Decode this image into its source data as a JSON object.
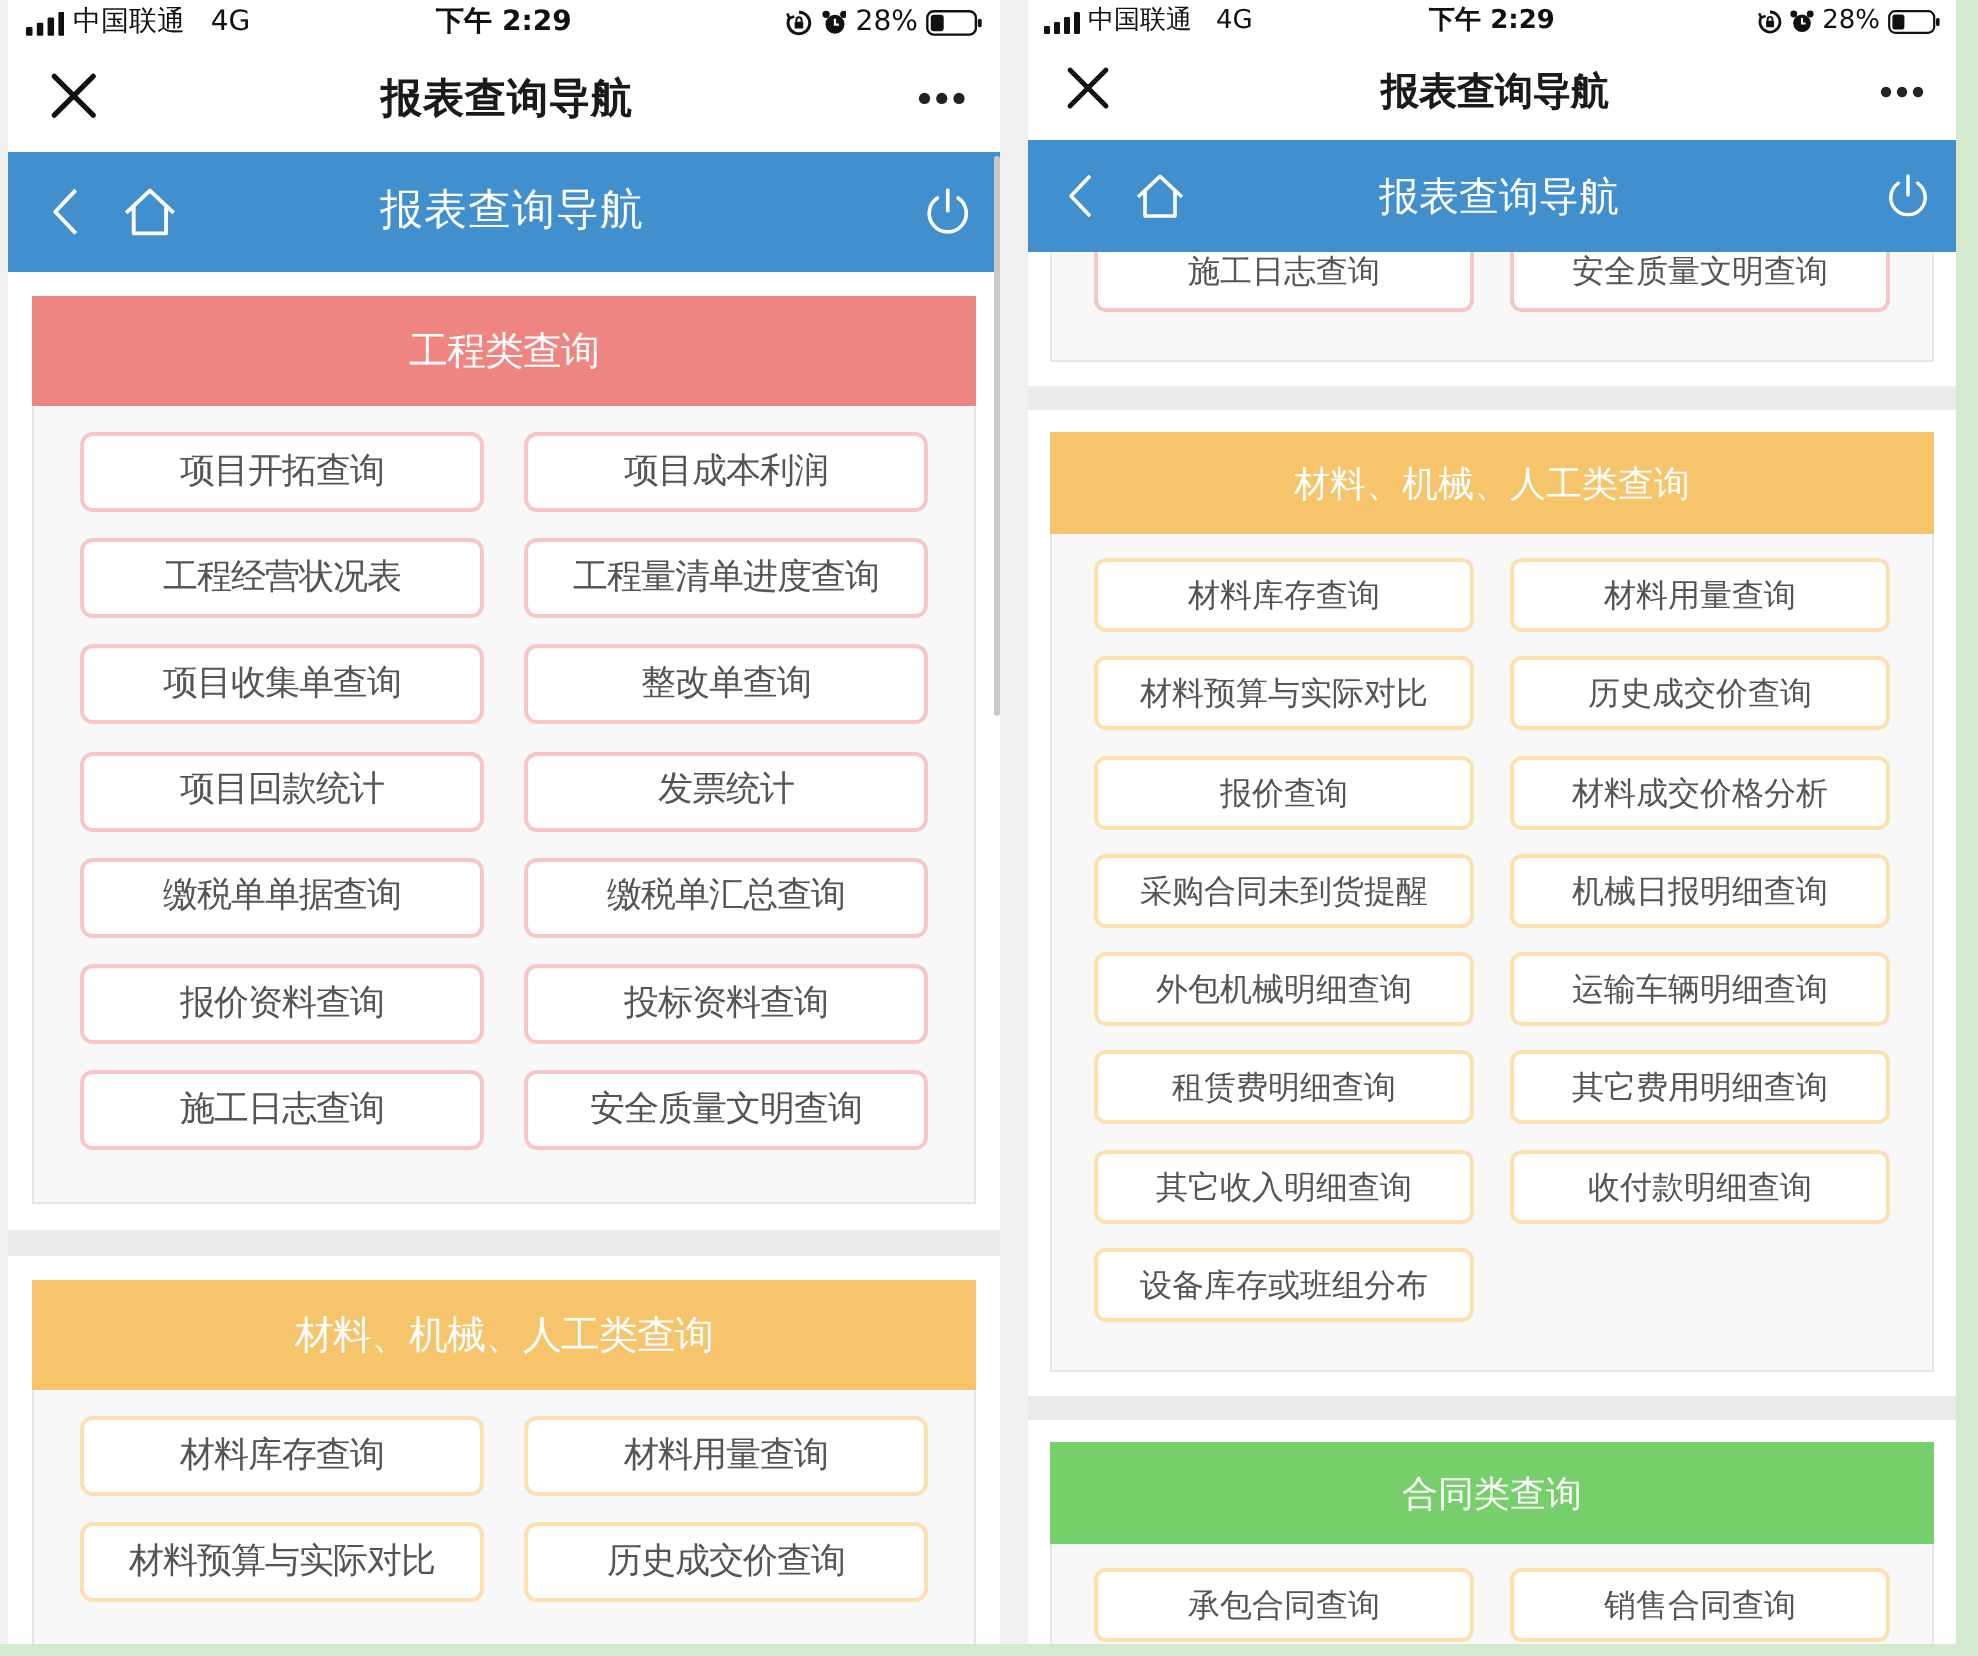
{
  "phones": [
    {
      "status_bar": {
        "carrier": "中国联通",
        "network": "4G",
        "time": "下午 2:29",
        "battery": "28%"
      },
      "nav_bar": {
        "title": "报表查询导航"
      },
      "app_header": {
        "title": "报表查询导航"
      },
      "sections": [
        {
          "title": "工程类查询",
          "color": "#ef8580",
          "buttons": {
            "color": "#f8c7c5",
            "labels": [
              "项目开拓查询",
              "项目成本利润",
              "工程经营状况表",
              "工程量清单进度查询",
              "项目收集单查询",
              "整改单查询",
              "项目回款统计",
              "发票统计",
              "缴税单单据查询",
              "缴税单汇总查询",
              "报价资料查询",
              "投标资料查询",
              "施工日志查询",
              "安全质量文明查询"
            ]
          }
        },
        {
          "title": "材料、机械、人工类查询",
          "color": "#f5c46b",
          "buttons": {
            "color": "#fce0ae",
            "labels": [
              "材料库存查询",
              "材料用量查询",
              "材料预算与实际对比",
              "历史成交价查询"
            ]
          }
        }
      ]
    },
    {
      "status_bar": {
        "carrier": "中国联通",
        "network": "4G",
        "time": "下午 2:29",
        "battery": "28%"
      },
      "nav_bar": {
        "title": "报表查询导航"
      },
      "app_header": {
        "title": "报表查询导航"
      },
      "sections": [
        {
          "buttons": {
            "color": "#f8c7c5",
            "labels": [
              "施工日志查询",
              "安全质量文明查询"
            ]
          }
        },
        {
          "title": "材料、机械、人工类查询",
          "color": "#f5c46b",
          "buttons": {
            "color": "#fce0ae",
            "labels": [
              "材料库存查询",
              "材料用量查询",
              "材料预算与实际对比",
              "历史成交价查询",
              "报价查询",
              "材料成交价格分析",
              "采购合同未到货提醒",
              "机械日报明细查询",
              "外包机械明细查询",
              "运输车辆明细查询",
              "租赁费明细查询",
              "其它费用明细查询",
              "其它收入明细查询",
              "收付款明细查询",
              "设备库存或班组分布"
            ]
          }
        },
        {
          "title": "合同类查询",
          "color": "#77cf6b",
          "buttons": {
            "color": "#fce0ae",
            "labels": [
              "承包合同查询",
              "销售合同查询"
            ]
          }
        }
      ]
    }
  ]
}
